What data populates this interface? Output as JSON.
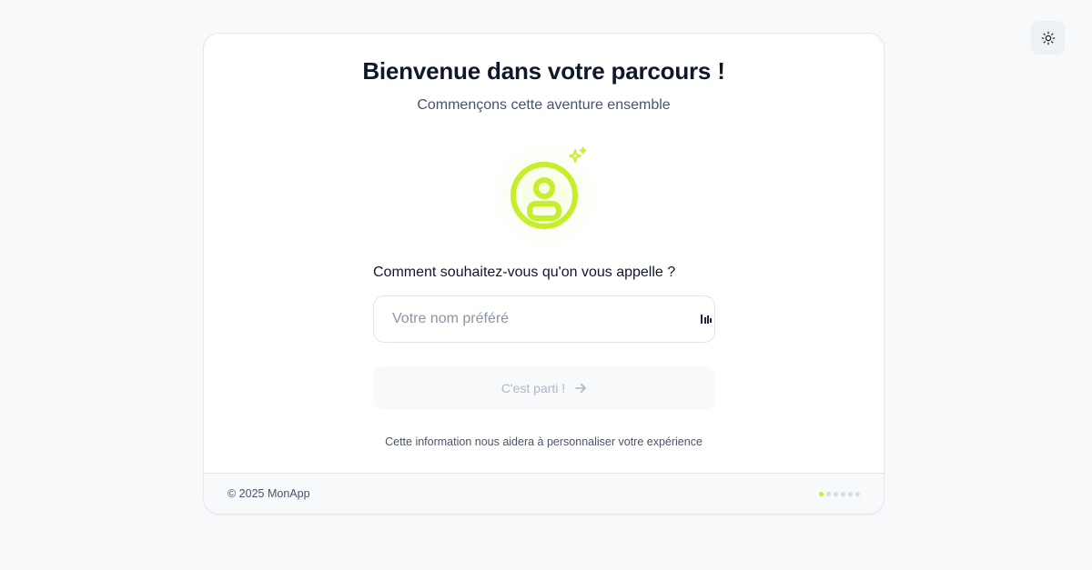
{
  "header": {
    "theme_toggle_icon": "sun-icon"
  },
  "card": {
    "title": "Bienvenue dans votre parcours !",
    "subtitle": "Commençons cette aventure ensemble",
    "avatar_icon": "user-circle-icon",
    "sparkle_icon": "sparkles-icon",
    "question": "Comment souhaitez-vous qu'on vous appelle ?",
    "name_input": {
      "value": "",
      "placeholder": "Votre nom préféré"
    },
    "submit_label": "C'est parti !",
    "submit_icon": "arrow-right-icon",
    "hint": "Cette information nous aidera à personnaliser votre expérience"
  },
  "footer": {
    "copyright": "© 2025 MonApp",
    "progress": {
      "total_steps": 6,
      "current_step": 1
    }
  },
  "colors": {
    "accent": "#c6ee2a",
    "text_primary": "#0f172a",
    "text_secondary": "#475569",
    "background": "#f7f9fb"
  }
}
